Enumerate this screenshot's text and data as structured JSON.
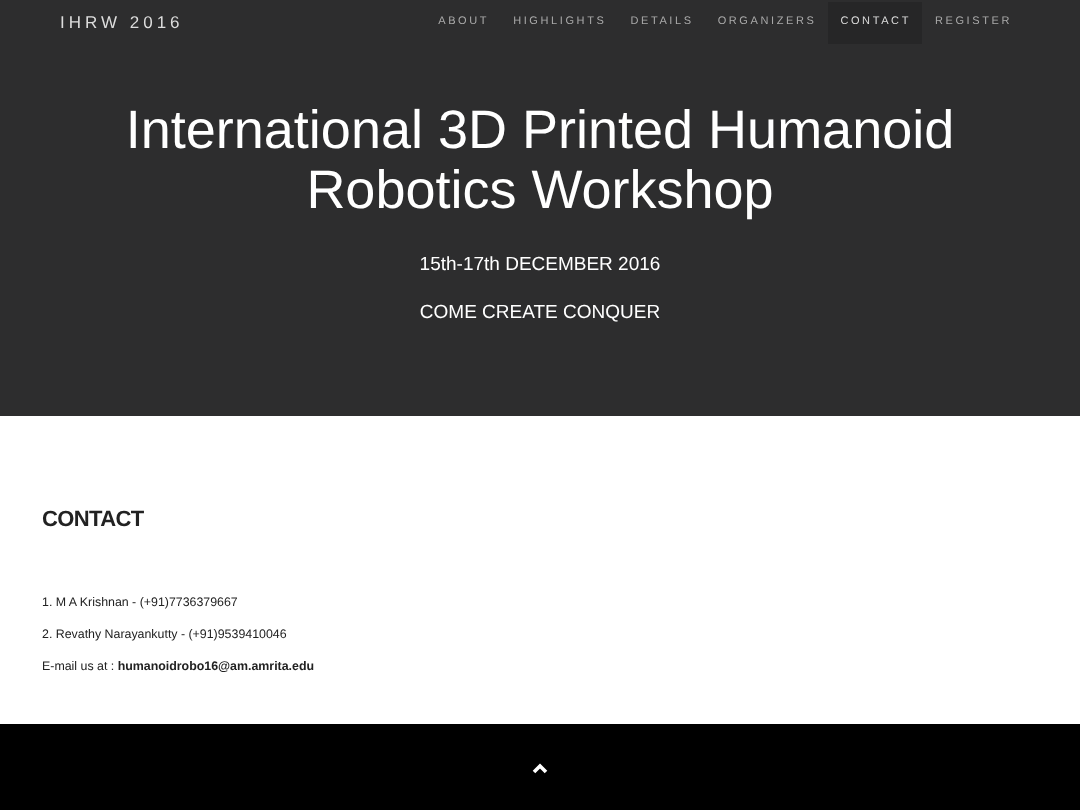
{
  "brand": "IHRW 2016",
  "nav": [
    {
      "label": "ABOUT",
      "selected": false
    },
    {
      "label": "HIGHLIGHTS",
      "selected": false
    },
    {
      "label": "DETAILS",
      "selected": false
    },
    {
      "label": "ORGANIZERS",
      "selected": false
    },
    {
      "label": "CONTACT",
      "selected": true
    },
    {
      "label": "REGISTER",
      "selected": false
    }
  ],
  "hero": {
    "title": "International 3D Printed Humanoid Robotics Workshop",
    "date": "15th-17th DECEMBER 2016",
    "tagline": "COME CREATE CONQUER"
  },
  "contact": {
    "heading": "CONTACT",
    "lines": [
      "1. M A Krishnan - (+91)7736379667",
      "2. Revathy Narayankutty - (+91)9539410046",
      "E-mail us at : **humanoidrobo16@am.amrita.edu**"
    ]
  }
}
